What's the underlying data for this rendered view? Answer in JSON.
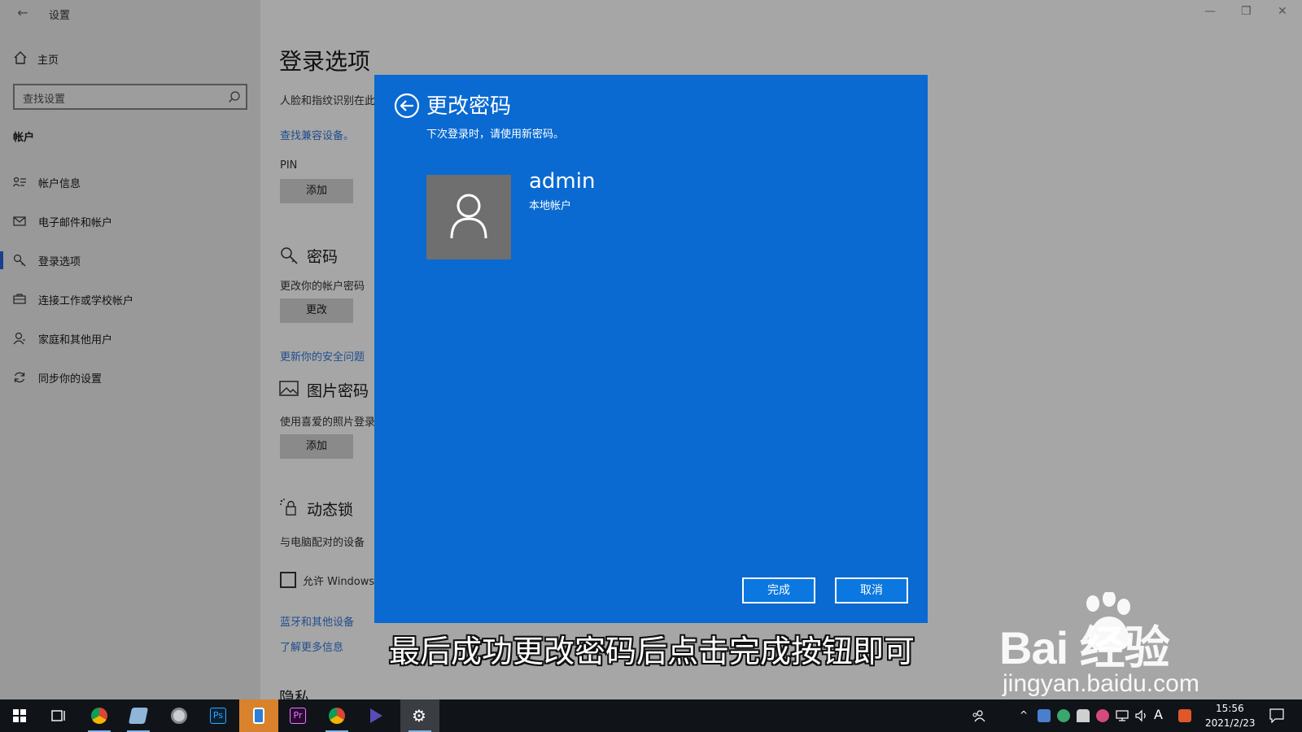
{
  "window": {
    "title": "设置"
  },
  "sidebar": {
    "home_label": "主页",
    "search_placeholder": "查找设置",
    "section_heading": "帐户",
    "items": [
      {
        "label": "帐户信息",
        "icon": "account-info-icon"
      },
      {
        "label": "电子邮件和帐户",
        "icon": "mail-icon"
      },
      {
        "label": "登录选项",
        "icon": "key-icon",
        "active": true
      },
      {
        "label": "连接工作或学校帐户",
        "icon": "briefcase-icon"
      },
      {
        "label": "家庭和其他用户",
        "icon": "person-icon"
      },
      {
        "label": "同步你的设置",
        "icon": "sync-icon"
      }
    ]
  },
  "main": {
    "title": "登录选项",
    "face_text": "人脸和指纹识别在此",
    "find_devices_link": "查找兼容设备。",
    "pin_label": "PIN",
    "pin_add": "添加",
    "password_heading": "密码",
    "password_desc": "更改你的帐户密码",
    "password_change": "更改",
    "security_link": "更新你的安全问题",
    "picture_heading": "图片密码",
    "picture_desc": "使用喜爱的照片登录",
    "picture_add": "添加",
    "dynamic_heading": "动态锁",
    "dynamic_desc": "与电脑配对的设备",
    "allow_windows": "允许 Windows",
    "bluetooth_link": "蓝牙和其他设备",
    "learn_more_link": "了解更多信息",
    "privacy_heading": "隐私"
  },
  "dialog": {
    "title": "更改密码",
    "subtitle": "下次登录时，请使用新密码。",
    "user_name": "admin",
    "account_type": "本地帐户",
    "finish_label": "完成",
    "cancel_label": "取消"
  },
  "caption": "最后成功更改密码后点击完成按钮即可",
  "watermark": {
    "logo": "Bai  经验",
    "url": "jingyan.baidu.com"
  },
  "taskbar": {
    "time": "15:56",
    "date": "2021/2/23",
    "ime": "A"
  },
  "colors": {
    "dialog_bg": "#0a6ad1",
    "button_bg": "#0a78e0",
    "link": "#1f4d8f",
    "taskbar": "#101318"
  }
}
